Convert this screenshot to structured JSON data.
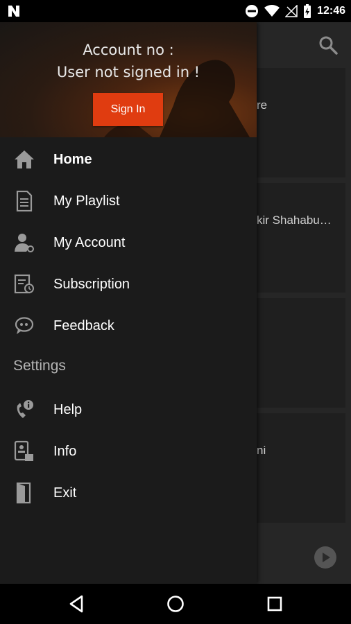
{
  "status_bar": {
    "time": "12:46",
    "icons": [
      "n-app-icon",
      "do-not-disturb-icon",
      "wifi-icon",
      "no-signal-icon",
      "battery-icon"
    ]
  },
  "drawer": {
    "account_no_label": "Account no :",
    "user_status": "User not signed in !",
    "sign_in_label": "Sign In",
    "accent_color": "#e03c10",
    "items": [
      {
        "label": "Home",
        "icon": "home-icon"
      },
      {
        "label": "My Playlist",
        "icon": "playlist-icon"
      },
      {
        "label": "My Account",
        "icon": "account-icon"
      },
      {
        "label": "Subscription",
        "icon": "subscription-icon"
      },
      {
        "label": "Feedback",
        "icon": "feedback-icon"
      }
    ],
    "settings_heading": "Settings",
    "settings_items": [
      {
        "label": "Help",
        "icon": "help-icon"
      },
      {
        "label": "Info",
        "icon": "info-icon"
      },
      {
        "label": "Exit",
        "icon": "exit-icon"
      }
    ]
  },
  "background": {
    "cards": [
      {
        "text": "re"
      },
      {
        "text": "kir Shahabu…"
      },
      {
        "text": ""
      },
      {
        "text": "ni"
      }
    ]
  },
  "nav_bar": {
    "icons": [
      "back-icon",
      "home-circle-icon",
      "recents-icon"
    ]
  }
}
